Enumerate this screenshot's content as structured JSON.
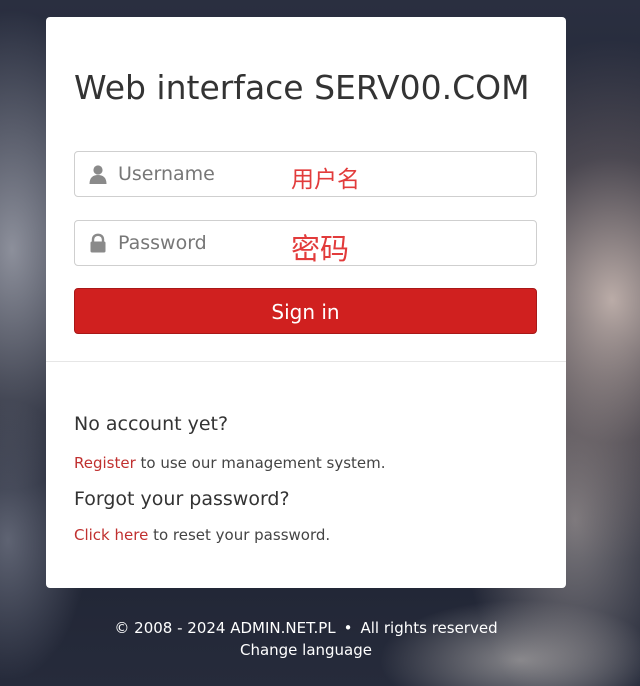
{
  "title": "Web interface SERV00.COM",
  "username": {
    "placeholder": "Username",
    "value": "",
    "annotation": "用户名",
    "icon": "user-icon"
  },
  "password": {
    "placeholder": "Password",
    "value": "",
    "annotation": "密码",
    "icon": "lock-icon"
  },
  "signin_label": "Sign in",
  "register": {
    "heading": "No account yet?",
    "link": "Register",
    "text": " to use our management system."
  },
  "forgot": {
    "heading": "Forgot your password?",
    "link": "Click here",
    "text": " to reset your password."
  },
  "footer": {
    "copyright": "© 2008 - 2024 ADMIN.NET.PL",
    "separator": "•",
    "rights": "All rights reserved",
    "change_language": "Change language"
  },
  "colors": {
    "accent": "#d0201f",
    "link": "#c0302f",
    "annotation": "#e23b3b"
  }
}
